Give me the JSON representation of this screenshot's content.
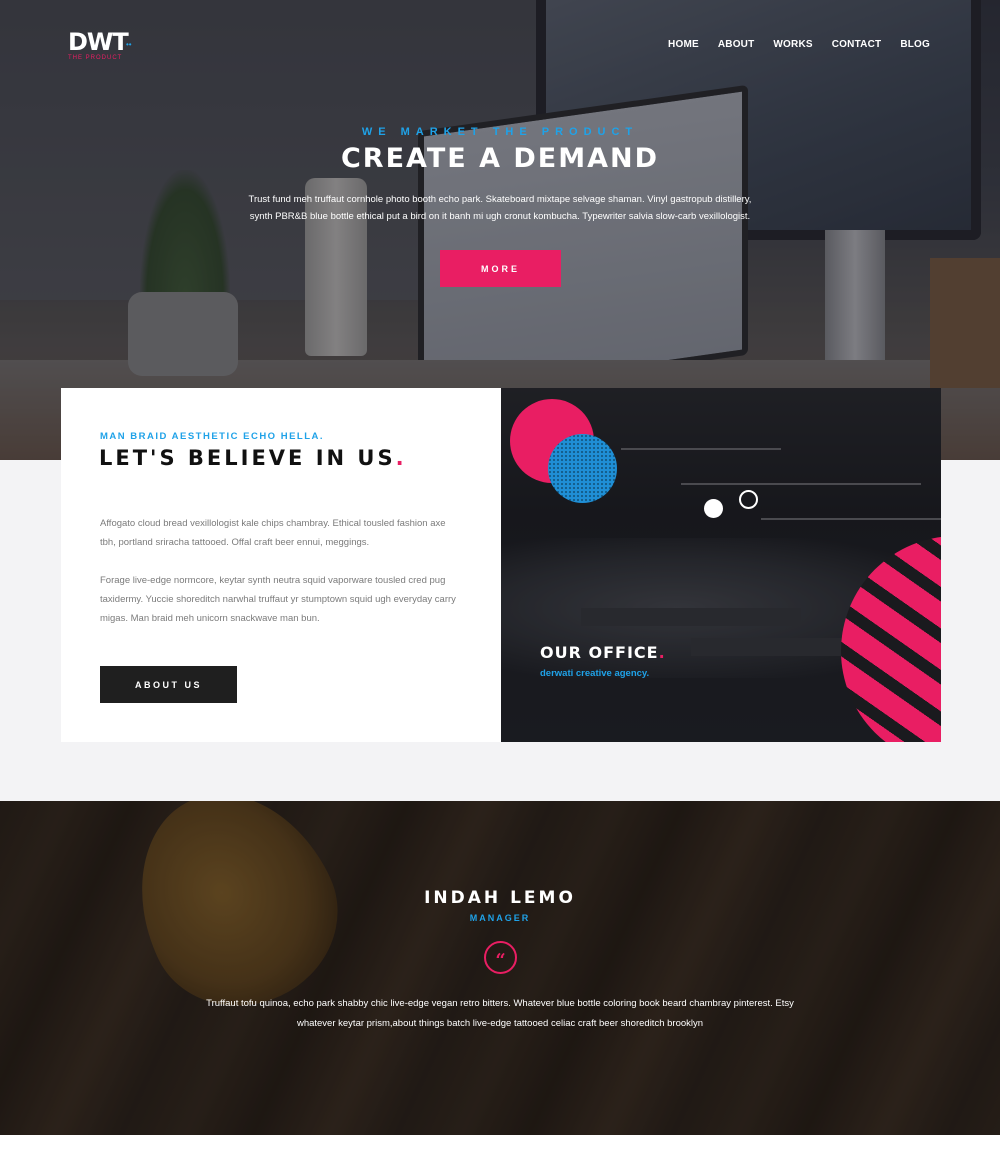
{
  "brand": {
    "logo_text": "DWT",
    "logo_dots": "••",
    "logo_sub": "THE PRODUCT"
  },
  "nav": {
    "items": [
      "HOME",
      "ABOUT",
      "WORKS",
      "CONTACT",
      "BLOG"
    ]
  },
  "hero": {
    "eyebrow": "WE MARKET THE PRODUCT",
    "title": "CREATE A DEMAND",
    "text": "Trust fund meh truffaut cornhole photo booth echo park. Skateboard mixtape selvage shaman. Vinyl gastropub distillery, synth PBR&B blue bottle ethical put a bird on it banh mi ugh cronut kombucha. Typewriter salvia slow-carb vexillologist.",
    "button_label": "MORE"
  },
  "about": {
    "eyebrow": "MAN BRAID AESTHETIC ECHO HELLA.",
    "title": "LET'S BELIEVE IN US",
    "title_dot": ".",
    "paragraph_1": "Affogato cloud bread vexillologist kale chips chambray. Ethical tousled fashion axe tbh, portland sriracha tattooed. Offal craft beer ennui, meggings.",
    "paragraph_2": "Forage live-edge normcore, keytar synth neutra squid vaporware tousled cred pug taxidermy. Yuccie shoreditch narwhal truffaut yr stumptown squid ugh everyday carry migas. Man braid meh unicorn snackwave man bun.",
    "button_label": "ABOUT US"
  },
  "office": {
    "title": "OUR OFFICE",
    "title_dot": ".",
    "subtitle": "derwati creative agency."
  },
  "testimonial": {
    "name": "INDAH LEMO",
    "role": "MANAGER",
    "quote_icon": "quote-icon",
    "text": "Truffaut tofu quinoa, echo park shabby chic live-edge vegan retro bitters. Whatever blue bottle coloring book beard chambray pinterest. Etsy whatever keytar prism,about things batch live-edge tattooed celiac craft beer shoreditch brooklyn"
  },
  "colors": {
    "accent_pink": "#e91e63",
    "accent_blue": "#1fa2e8",
    "dark": "#1f1f1f",
    "light_bg": "#f3f3f5"
  }
}
